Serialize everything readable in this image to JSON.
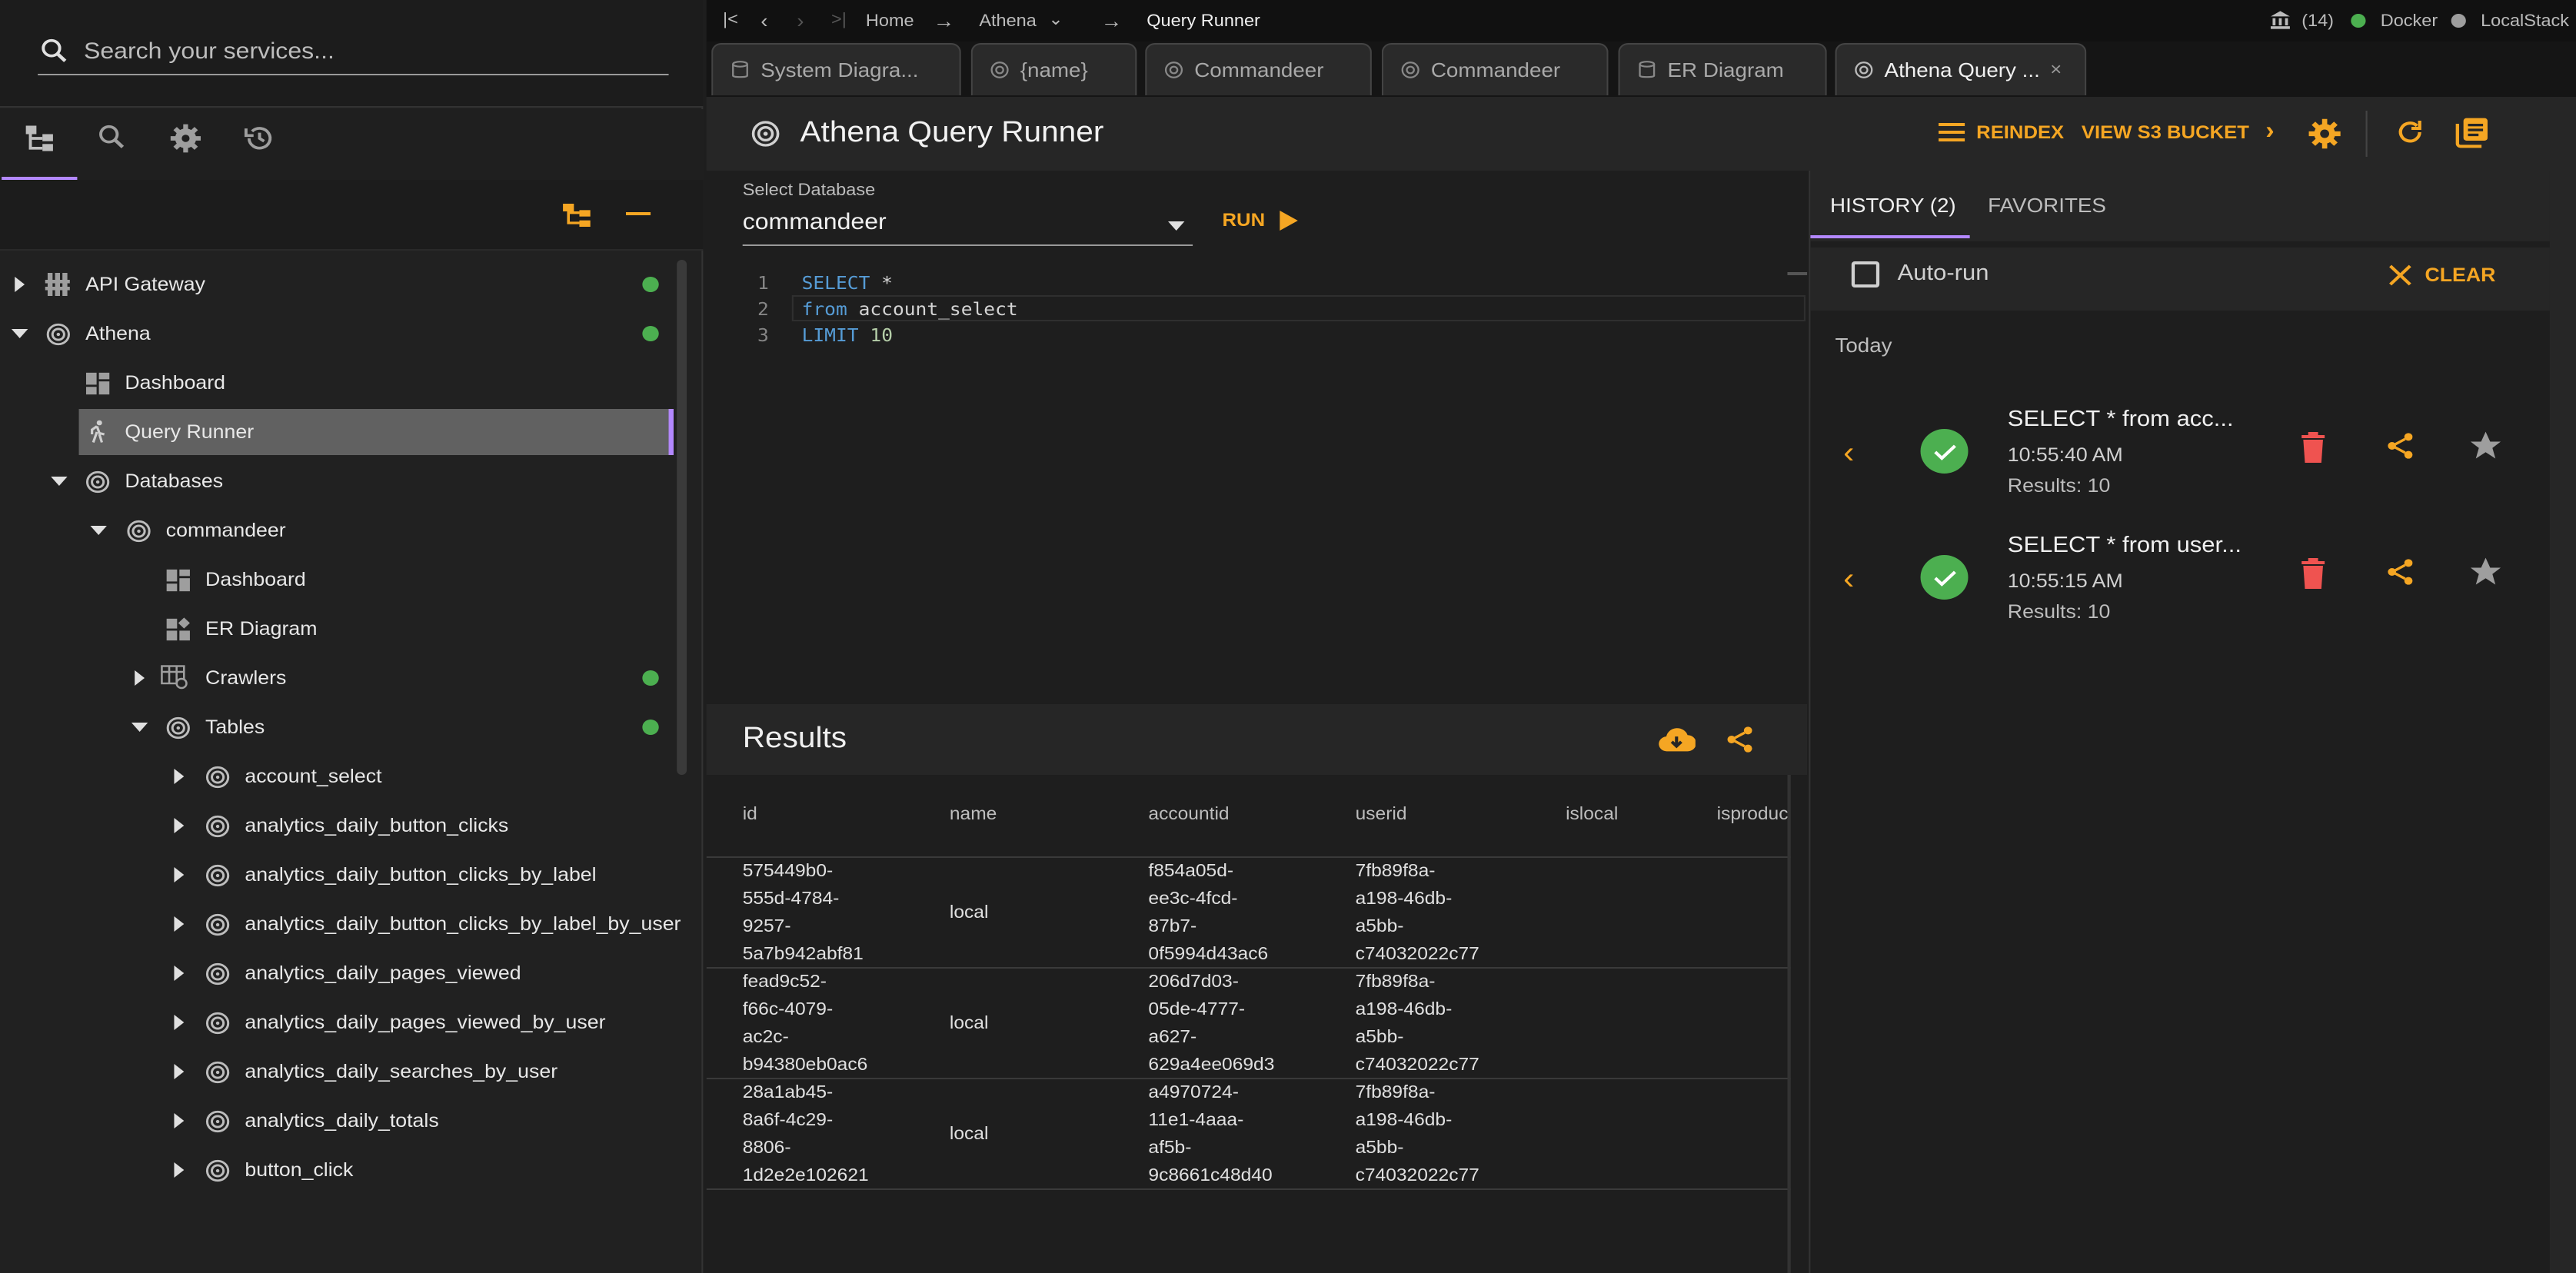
{
  "sidebar": {
    "search_placeholder": "Search your services...",
    "tree": [
      {
        "label": "API Gateway"
      },
      {
        "label": "Athena"
      },
      {
        "label": "Dashboard"
      },
      {
        "label": "Query Runner"
      },
      {
        "label": "Databases"
      },
      {
        "label": "commandeer"
      },
      {
        "label": "Dashboard"
      },
      {
        "label": "ER Diagram"
      },
      {
        "label": "Crawlers"
      },
      {
        "label": "Tables"
      },
      {
        "label": "account_select"
      },
      {
        "label": "analytics_daily_button_clicks"
      },
      {
        "label": "analytics_daily_button_clicks_by_label"
      },
      {
        "label": "analytics_daily_button_clicks_by_label_by_user"
      },
      {
        "label": "analytics_daily_pages_viewed"
      },
      {
        "label": "analytics_daily_pages_viewed_by_user"
      },
      {
        "label": "analytics_daily_searches_by_user"
      },
      {
        "label": "analytics_daily_totals"
      },
      {
        "label": "button_click"
      }
    ],
    "status_colors": {
      "active": "#4caf50"
    },
    "selected_accent": "#b388ff"
  },
  "topbar": {
    "home": "Home",
    "service": "Athena",
    "current": "Query Runner",
    "count": "(14)",
    "docker": "Docker",
    "localstack": "LocalStack"
  },
  "tabs": [
    {
      "label": "System Diagra..."
    },
    {
      "label": "{name}"
    },
    {
      "label": "Commandeer"
    },
    {
      "label": "Commandeer"
    },
    {
      "label": "ER Diagram"
    },
    {
      "label": "Athena Query ..."
    }
  ],
  "header": {
    "title": "Athena Query Runner",
    "reindex": "REINDEX",
    "view_s3": "VIEW S3 BUCKET"
  },
  "editor": {
    "db_label": "Select Database",
    "db_value": "commandeer",
    "run": "RUN",
    "lines": [
      {
        "n": "1",
        "kw": "SELECT",
        "rest": " *"
      },
      {
        "n": "2",
        "kw": "from",
        "rest": " account_select"
      },
      {
        "n": "3",
        "kw": "LIMIT",
        "rest": "10"
      }
    ]
  },
  "results": {
    "title": "Results",
    "columns": [
      "id",
      "name",
      "accountid",
      "userid",
      "islocal",
      "isproduc"
    ],
    "rows": [
      {
        "id": [
          "575449b0-",
          "555d-4784-",
          "9257-",
          "5a7b942abf81"
        ],
        "name": "local",
        "accountid": [
          "f854a05d-",
          "ee3c-4fcd-",
          "87b7-",
          "0f5994d43ac6"
        ],
        "userid": [
          "7fb89f8a-",
          "a198-46db-",
          "a5bb-",
          "c74032022c77"
        ]
      },
      {
        "id": [
          "fead9c52-",
          "f66c-4079-",
          "ac2c-",
          "b94380eb0ac6"
        ],
        "name": "local",
        "accountid": [
          "206d7d03-",
          "05de-4777-",
          "a627-",
          "629a4ee069d3"
        ],
        "userid": [
          "7fb89f8a-",
          "a198-46db-",
          "a5bb-",
          "c74032022c77"
        ]
      },
      {
        "id": [
          "28a1ab45-",
          "8a6f-4c29-",
          "8806-",
          "1d2e2e102621"
        ],
        "name": "local",
        "accountid": [
          "a4970724-",
          "11e1-4aaa-",
          "af5b-",
          "9c8661c48d40"
        ],
        "userid": [
          "7fb89f8a-",
          "a198-46db-",
          "a5bb-",
          "c74032022c77"
        ]
      }
    ]
  },
  "history": {
    "tab_history": "HISTORY (2)",
    "tab_favorites": "FAVORITES",
    "autorun": "Auto-run",
    "clear": "CLEAR",
    "group": "Today",
    "items": [
      {
        "query": "SELECT * from acc...",
        "time": "10:55:40 AM",
        "results": "Results: 10"
      },
      {
        "query": "SELECT * from user...",
        "time": "10:55:15 AM",
        "results": "Results: 10"
      }
    ]
  },
  "colors": {
    "accent": "#f5a623",
    "delete": "#ef5350",
    "success": "#4caf50",
    "purple": "#b388ff"
  }
}
